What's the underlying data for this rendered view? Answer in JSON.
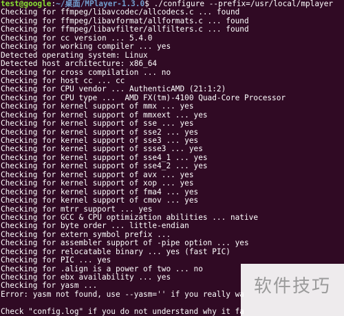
{
  "prompt": {
    "user_host": "test@google",
    "separator": ":",
    "path": "~/桌面/MPlayer-1.3.0",
    "symbol": "$",
    "command": " ./configure --prefix=/usr/local/mplayer"
  },
  "output_lines": [
    "Checking for ffmpeg/libavcodec/allcodecs.c ... found",
    "Checking for ffmpeg/libavformat/allformats.c ... found",
    "Checking for ffmpeg/libavfilter/allfilters.c ... found",
    "Checking for cc version ... 5.4.0",
    "Checking for working compiler ... yes",
    "Detected operating system: Linux",
    "Detected host architecture: x86_64",
    "Checking for cross compilation ... no",
    "Checking for host cc ... cc",
    "Checking for CPU vendor ... AuthenticAMD (21:1:2)",
    "Checking for CPU type ...  AMD FX(tm)-4100 Quad-Core Processor",
    "Checking for kernel support of mmx ... yes",
    "Checking for kernel support of mmxext ... yes",
    "Checking for kernel support of sse ... yes",
    "Checking for kernel support of sse2 ... yes",
    "Checking for kernel support of sse3 ... yes",
    "Checking for kernel support of ssse3 ... yes",
    "Checking for kernel support of sse4_1 ... yes",
    "Checking for kernel support of sse4_2 ... yes",
    "Checking for kernel support of avx ... yes",
    "Checking for kernel support of xop ... yes",
    "Checking for kernel support of fma4 ... yes",
    "Checking for kernel support of cmov ... yes",
    "Checking for mtrr support ... yes",
    "Checking for GCC & CPU optimization abilities ... native",
    "Checking for byte order ... little-endian",
    "Checking for extern symbol prefix ...",
    "Checking for assembler support of -pipe option ... yes",
    "Checking for relocatable binary ... yes (fast PIC)",
    "Checking for PIC ... yes",
    "Checking for .align is a power of two ... no",
    "Checking for ebx availability ... yes",
    "Checking for yasm ...",
    "Error: yasm not found, use --yasm='' if you really wa",
    "",
    "Check \"config.log\" if you do not understand why it fa"
  ],
  "watermark": {
    "text": "软件技巧"
  },
  "colors": {
    "background": "#300a24",
    "prompt_user": "#8ae234",
    "prompt_path": "#729fcf",
    "text": "#ffffff"
  }
}
